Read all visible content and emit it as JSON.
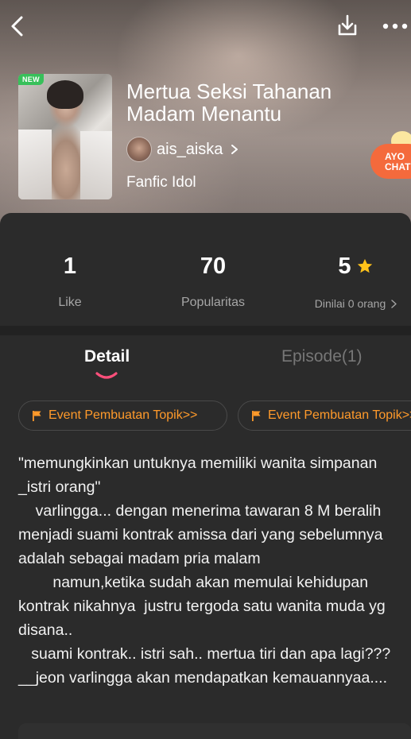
{
  "header": {
    "back_icon": "chevron-left-icon",
    "download_icon": "download-icon",
    "more_icon": "more-dots-icon"
  },
  "book": {
    "badge": "NEW",
    "title": "Mertua Seksi Tahanan Madam Menantu",
    "author": "ais_aiska",
    "genre": "Fanfic Idol"
  },
  "chat_widget": {
    "label": "AYO CHAT"
  },
  "stats": {
    "like_value": "1",
    "like_label": "Like",
    "popularity_value": "70",
    "popularity_label": "Popularitas",
    "rating_value": "5",
    "rating_label": "Dinilai 0 orang"
  },
  "tabs": [
    {
      "label": "Detail",
      "active": true
    },
    {
      "label": "Episode(1)",
      "active": false
    }
  ],
  "event_chips": [
    {
      "label": "Event Pembuatan Topik>>"
    },
    {
      "label": "Event Pembuatan Topik>>"
    }
  ],
  "synopsis": "\"memungkinkan untuknya memiliki wanita simpanan _istri orang\"\n    varlingga... dengan menerima tawaran 8 M beralih menjadi suami kontrak amissa dari yang sebelumnya adalah sebagai madam pria malam\n        namun,ketika sudah akan memulai kehidupan kontrak nikahnya  justru tergoda satu wanita muda yg disana..\n   suami kontrak.. istri sah.. mertua tiri dan apa lagi???  __jeon varlingga akan mendapatkan kemauannyaa....",
  "colors": {
    "accent_orange": "#ff9a2b",
    "tab_indicator": "#ff4f7b",
    "star": "#ffc21a",
    "badge_green": "#38c05a",
    "chat_orange": "#f46a3c"
  }
}
